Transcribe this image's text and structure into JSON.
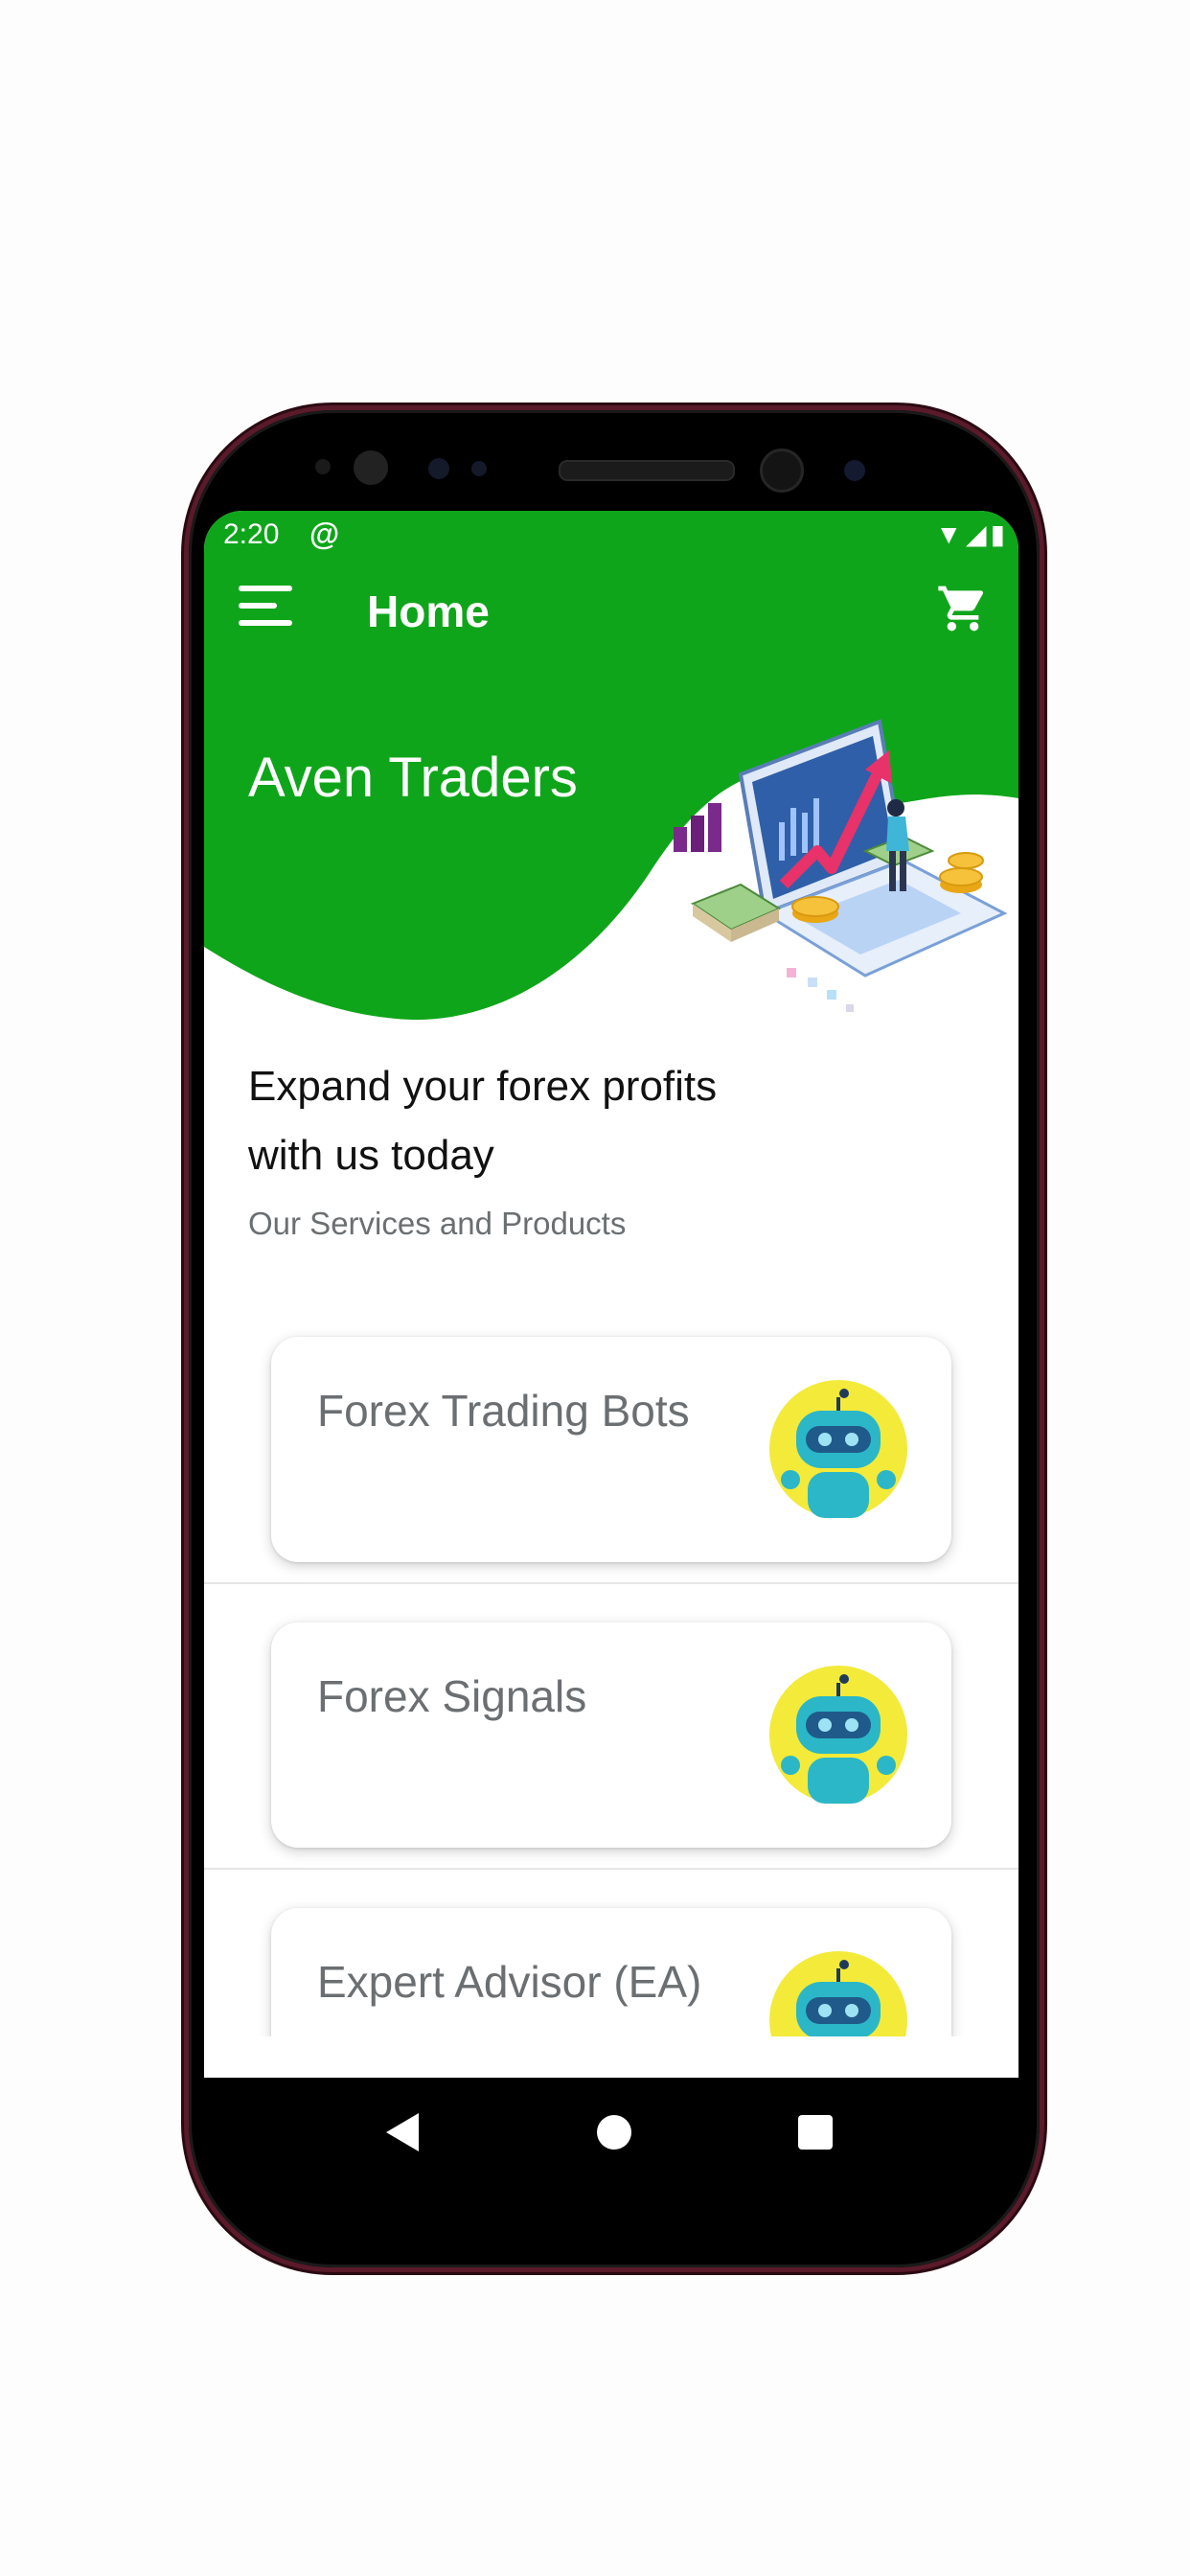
{
  "status_bar": {
    "time": "2:20",
    "notification_icon": "at-sign-icon",
    "system_icons": [
      "wifi-icon",
      "signal-icon",
      "battery-icon"
    ]
  },
  "app_bar": {
    "title": "Home",
    "menu_icon": "hamburger-menu-icon",
    "cart_icon": "shopping-cart-icon"
  },
  "hero": {
    "brand": "Aven Traders",
    "illustration": "trading-laptop-illustration"
  },
  "content": {
    "tagline": "Expand your forex profits with us today",
    "section_title": "Our Services and Products"
  },
  "services": [
    {
      "label": "Forex Trading Bots",
      "icon": "robot-icon"
    },
    {
      "label": "Forex Signals",
      "icon": "robot-icon"
    },
    {
      "label": "Expert Advisor (EA)",
      "icon": "robot-icon"
    }
  ],
  "nav_bar": {
    "buttons": [
      "back-icon",
      "home-icon",
      "recent-apps-icon"
    ]
  },
  "colors": {
    "primary": "#0fa51a",
    "card_text": "#6b6f72",
    "robot_bg": "#f3ea3a",
    "robot_body": "#2bb7c7"
  }
}
